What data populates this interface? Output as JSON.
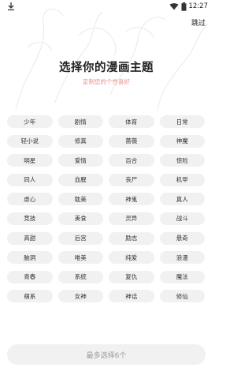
{
  "status_bar": {
    "time": "12:27",
    "icons": [
      "download-icon",
      "wifi-icon",
      "battery-icon"
    ]
  },
  "header": {
    "skip_label": "跳过",
    "title": "选择你的漫画主题",
    "subtitle": "定制您的个性喜好",
    "subtitle_color": "#f08a8a"
  },
  "topics": [
    "少年",
    "剧情",
    "体育",
    "日常",
    "轻小说",
    "修真",
    "蔷薇",
    "神魔",
    "明星",
    "爱情",
    "百合",
    "惊险",
    "同人",
    "血腥",
    "丧尸",
    "机甲",
    "虐心",
    "耽美",
    "神鬼",
    "真人",
    "竞技",
    "美食",
    "灵异",
    "战斗",
    "高甜",
    "后宫",
    "励志",
    "悬奇",
    "脑洞",
    "唯美",
    "纯爱",
    "浪漫",
    "青春",
    "系统",
    "复仇",
    "魔法",
    "萌系",
    "女神",
    "神话",
    "修仙"
  ],
  "footer": {
    "button_label": "最多选择6个"
  }
}
